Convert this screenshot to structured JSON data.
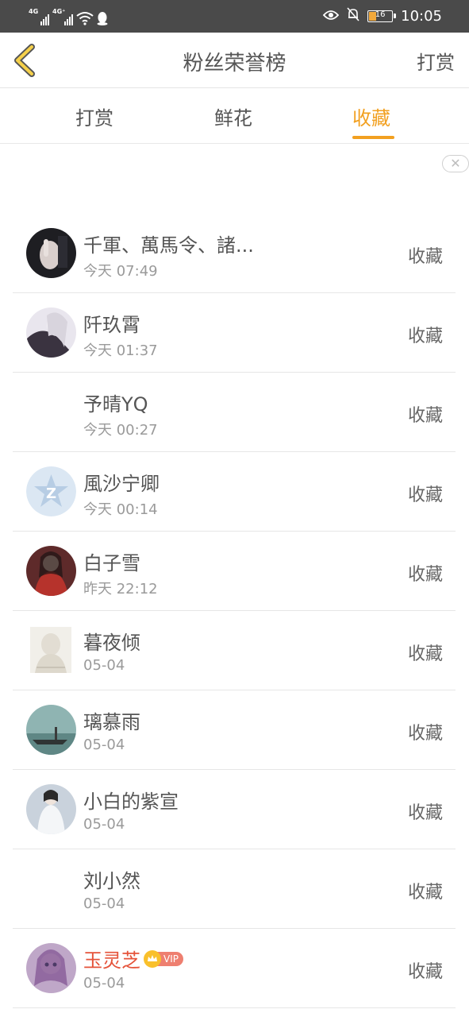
{
  "status_bar": {
    "network_1": "4G",
    "network_2": "4G⁺",
    "battery": "16",
    "time": "10:05"
  },
  "header": {
    "title": "粉丝荣誉榜",
    "right_action": "打赏"
  },
  "tabs": [
    {
      "label": "打赏",
      "active": false
    },
    {
      "label": "鲜花",
      "active": false
    },
    {
      "label": "收藏",
      "active": true
    }
  ],
  "accent_color": "#f2a020",
  "ad": {
    "close_icon": "close-icon"
  },
  "fans": [
    {
      "name": "千軍、萬馬令、諸...",
      "date": "今天 07:49",
      "action": "收藏",
      "avatar": "dark-photo"
    },
    {
      "name": "阡玖霄",
      "date": "今天 01:37",
      "action": "收藏",
      "avatar": "anime-white-hair"
    },
    {
      "name": "予晴YQ",
      "date": "今天 00:27",
      "action": "收藏",
      "avatar": "none"
    },
    {
      "name": "風沙宁卿",
      "date": "今天 00:14",
      "action": "收藏",
      "avatar": "default-star"
    },
    {
      "name": "白子雪",
      "date": "昨天 22:12",
      "action": "收藏",
      "avatar": "costume-red"
    },
    {
      "name": "暮夜倾",
      "date": "05-04",
      "action": "收藏",
      "avatar": "light-square"
    },
    {
      "name": "璃慕雨",
      "date": "05-04",
      "action": "收藏",
      "avatar": "boat-lake"
    },
    {
      "name": "小白的紫宣",
      "date": "05-04",
      "action": "收藏",
      "avatar": "white-robe"
    },
    {
      "name": "刘小然",
      "date": "05-04",
      "action": "收藏",
      "avatar": "none"
    },
    {
      "name": "玉灵芝",
      "date": "05-04",
      "action": "收藏",
      "avatar": "doll",
      "vip": true,
      "vip_label": "VIP"
    }
  ]
}
